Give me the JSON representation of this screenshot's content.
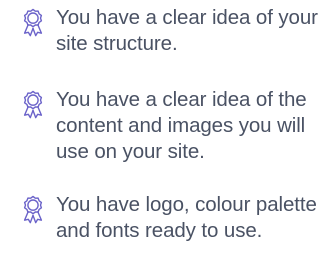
{
  "checklist": {
    "accent_color": "#6b63c9",
    "text_color": "#4a5264",
    "icon": "award-ribbon-icon",
    "items": [
      {
        "text": "You have a clear idea of your site structure."
      },
      {
        "text": "You have a clear idea of the content and images you will use on your site."
      },
      {
        "text": "You have logo, colour palette and fonts ready to use."
      }
    ]
  }
}
